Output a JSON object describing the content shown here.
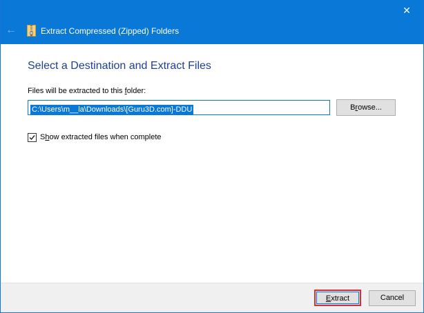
{
  "window": {
    "title": "Extract Compressed (Zipped) Folders",
    "close_glyph": "✕",
    "back_glyph": "←"
  },
  "main": {
    "heading": "Select a Destination and Extract Files",
    "folder_label_pre": "Files will be extracted to this ",
    "folder_label_u": "f",
    "folder_label_post": "older:",
    "path_value": "C:\\Users\\m__la\\Downloads\\[Guru3D.com]-DDU",
    "browse_pre": "B",
    "browse_u": "r",
    "browse_post": "owse...",
    "checkbox_checked": true,
    "checkbox_label_pre": "S",
    "checkbox_label_u": "h",
    "checkbox_label_post": "ow extracted files when complete"
  },
  "footer": {
    "extract_u": "E",
    "extract_post": "xtract",
    "cancel_label": "Cancel"
  },
  "colors": {
    "titlebar": "#0a78d7",
    "heading": "#1e3f95",
    "highlight": "#d32f3a"
  },
  "icons": {
    "back": "back-arrow-icon",
    "zip": "zip-folder-icon",
    "close": "close-icon",
    "check": "checkmark-icon"
  }
}
